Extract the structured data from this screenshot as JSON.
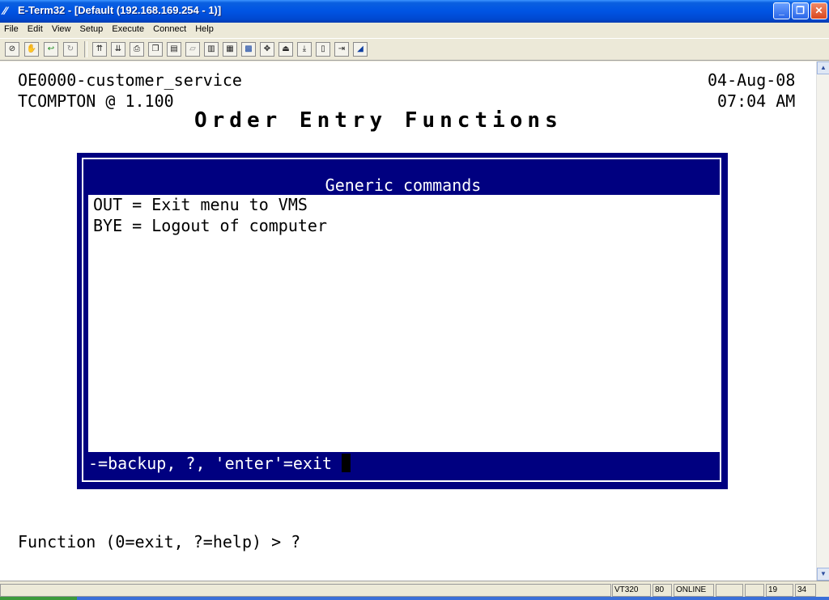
{
  "window": {
    "title": "E-Term32 - [Default (192.168.169.254 - 1)]",
    "minimize": "_",
    "maximize": "❐",
    "close": "✕"
  },
  "menu": [
    "File",
    "Edit",
    "View",
    "Setup",
    "Execute",
    "Connect",
    "Help"
  ],
  "toolbar_icons": [
    "disconnect-icon",
    "hand-icon",
    "connect-icon",
    "reconnect-icon",
    "send-icon",
    "receive-icon",
    "print-icon",
    "copy-icon",
    "paste-icon",
    "clear-icon",
    "capture-icon",
    "log-icon",
    "keypad-icon",
    "settings-icon",
    "transfer-up-icon",
    "transfer-down-icon",
    "file-icon",
    "exit-icon",
    "script-icon"
  ],
  "terminal": {
    "program": "OE0000-customer_service",
    "date": "04-Aug-08",
    "user": "TCOMPTON @ 1.100",
    "time": "07:04 AM",
    "screen_title": "Order Entry Functions",
    "menu_heading": "Generic commands",
    "menu_items": [
      "OUT = Exit menu to VMS",
      "BYE = Logout of computer"
    ],
    "menu_footer": "-=backup, ?, 'enter'=exit",
    "prompt": "Function (0=exit, ?=help) > ?"
  },
  "status": {
    "emulation": "VT320",
    "columns": "80",
    "state": "ONLINE",
    "row": "19",
    "col": "34"
  }
}
